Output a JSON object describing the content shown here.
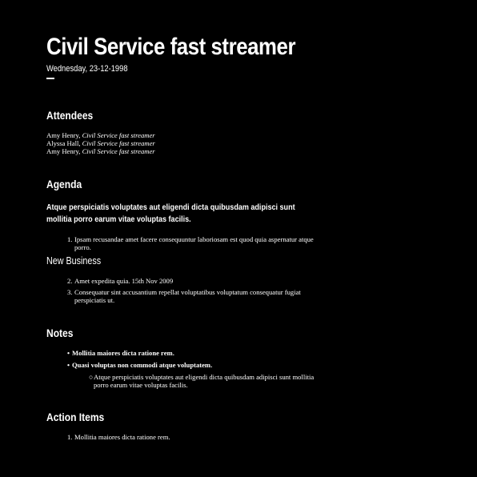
{
  "header": {
    "title": "Civil Service fast streamer",
    "date": "Wednesday, 23-12-1998"
  },
  "attendees": {
    "heading": "Attendees",
    "list": [
      {
        "name": "Amy Henry,",
        "role": "Civil Service fast streamer"
      },
      {
        "name": "Alyssa Hall,",
        "role": "Civil Service fast streamer"
      },
      {
        "name": "Amy Henry,",
        "role": "Civil Service fast streamer"
      }
    ]
  },
  "agenda": {
    "heading": "Agenda",
    "lead": "Atque perspiciatis voluptates aut eligendi dicta quibusdam adipisci sunt mollitia porro earum vitae voluptas facilis.",
    "items": [
      {
        "num": "1.",
        "text": "Ipsam recusandae amet facere consequuntur laboriosam est quod quia aspernatur atque porro."
      }
    ],
    "new_business_heading": "New Business",
    "new_business_items": [
      {
        "num": "2.",
        "text": "Amet expedita quia. 15th Nov 2009"
      },
      {
        "num": "3.",
        "text": "Consequatur sint accusantium repellat voluptatibus voluptatum consequatur fugiat perspiciatis ut."
      }
    ]
  },
  "notes": {
    "heading": "Notes",
    "items": [
      {
        "text": "Mollitia maiores dicta ratione rem."
      },
      {
        "text": "Quasi voluptas non commodi atque voluptatem."
      }
    ],
    "sub_items": [
      {
        "text": "Atque perspiciatis voluptates aut eligendi dicta quibusdam adipisci sunt mollitia porro earum vitae voluptas facilis."
      }
    ]
  },
  "action_items": {
    "heading": "Action Items",
    "items": [
      {
        "num": "1.",
        "text": "Mollitia maiores dicta ratione rem."
      }
    ]
  },
  "colors": {
    "background": "#000000",
    "text": "#ffffff"
  }
}
